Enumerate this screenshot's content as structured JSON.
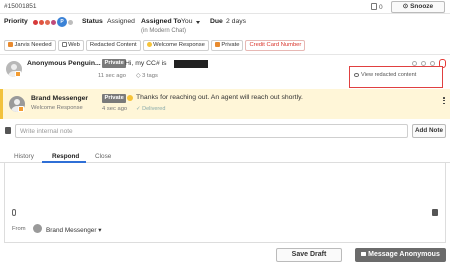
{
  "header": {
    "ticket_id": "#15001851",
    "count": "0",
    "snooze_label": "Snooze"
  },
  "fields": {
    "priority_label": "Priority",
    "priority_badge": "P",
    "status_label": "Status",
    "status_value": "Assigned",
    "assigned_label": "Assigned To",
    "assigned_value": "You",
    "assigned_sub": "(in Modern Chat)",
    "due_label": "Due",
    "due_value": "2 days"
  },
  "tags": [
    {
      "label": "Jarvis Needed",
      "icon": "jarvis-icon",
      "color": "#e88a2e"
    },
    {
      "label": "Web",
      "icon": "monitor-icon",
      "color": "#777777"
    },
    {
      "label": "Redacted Content",
      "icon": "",
      "color": ""
    },
    {
      "label": "Welcome Response",
      "icon": "emoji-icon",
      "color": "#f6c338"
    },
    {
      "label": "Private",
      "icon": "lock-icon",
      "color": "#e88a2e"
    },
    {
      "label": "Credit Card Number",
      "icon": "",
      "color": "#d9342b"
    }
  ],
  "messages": [
    {
      "sender": "Anonymous Penguin...",
      "private_label": "Private",
      "text": "Hi, my CC# is",
      "time": "11 sec ago",
      "tags_count": "3 tags"
    },
    {
      "sender": "Brand Messenger",
      "subtitle": "Welcome Response",
      "private_label": "Private",
      "text": "Thanks for reaching out. An agent will reach out shortly.",
      "time": "4 sec ago",
      "status": "Delivered"
    }
  ],
  "redact_popup": {
    "label": "View redacted content"
  },
  "note": {
    "placeholder": "Write internal note",
    "add_label": "Add Note"
  },
  "tabs": [
    "History",
    "Respond",
    "Close"
  ],
  "compose": {
    "from_label": "From",
    "from_value": "Brand Messenger"
  },
  "actions": {
    "save_draft": "Save Draft",
    "send": "Message Anonymous"
  },
  "colors": {
    "accent_blue": "#2f6fd6",
    "private_chip": "#7a7a7a",
    "highlight_bg": "#fff6d8",
    "alert_red": "#e53935"
  }
}
